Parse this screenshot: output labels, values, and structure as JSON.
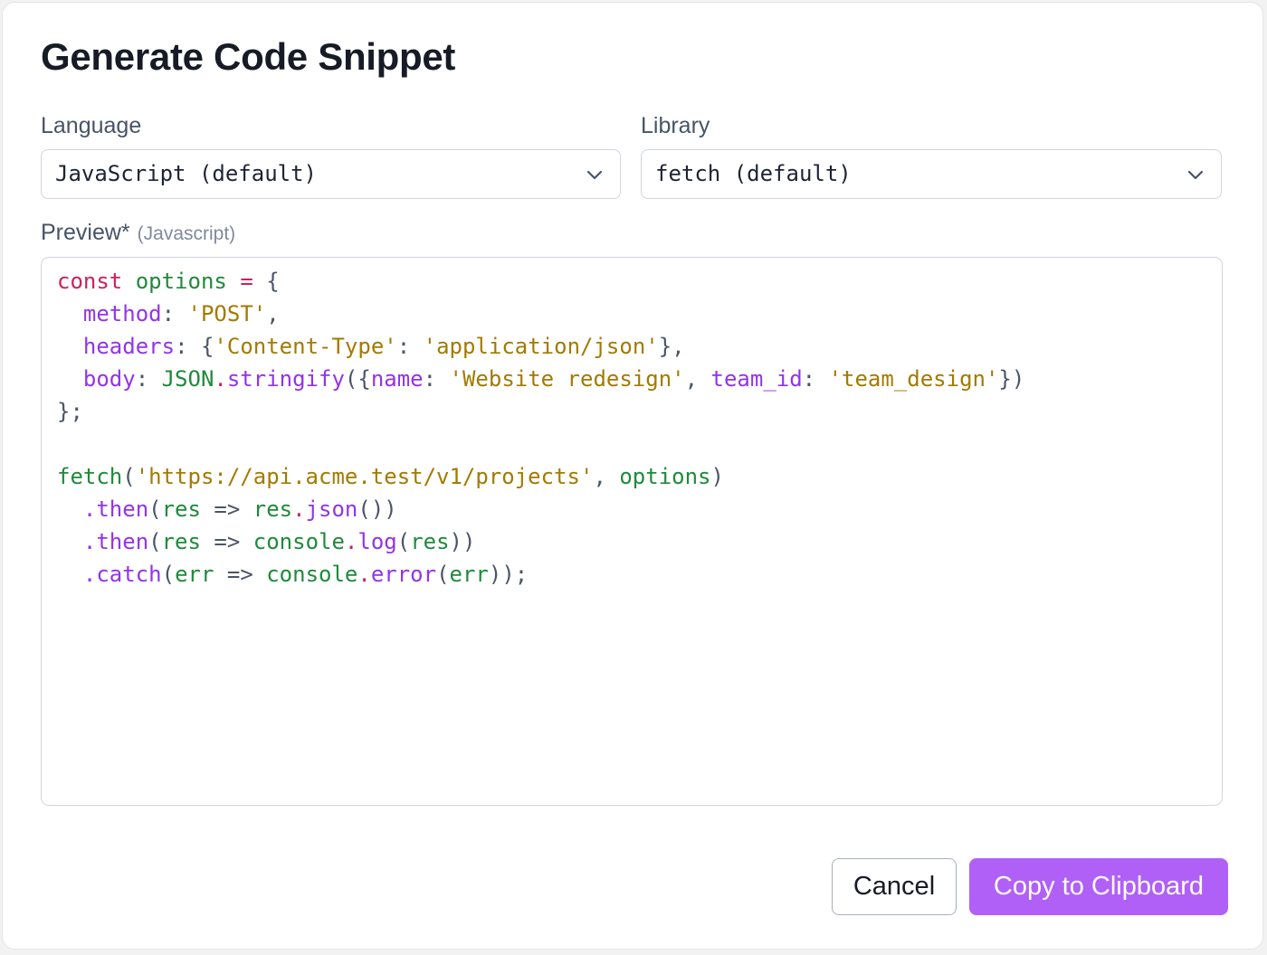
{
  "dialog": {
    "title": "Generate Code Snippet"
  },
  "language": {
    "label": "Language",
    "value": "JavaScript (default)",
    "icon": "chevron-down-icon"
  },
  "library": {
    "label": "Library",
    "value": "fetch (default)",
    "icon": "chevron-down-icon"
  },
  "preview": {
    "label": "Preview",
    "required_mark": "*",
    "language_hint": "(Javascript)",
    "lines": [
      [
        {
          "t": "const",
          "c": "keyword"
        },
        {
          "t": " ",
          "c": "plain"
        },
        {
          "t": "options",
          "c": "ident"
        },
        {
          "t": " ",
          "c": "plain"
        },
        {
          "t": "=",
          "c": "op"
        },
        {
          "t": " {",
          "c": "punct"
        }
      ],
      [
        {
          "t": "  ",
          "c": "plain"
        },
        {
          "t": "method",
          "c": "prop"
        },
        {
          "t": ": ",
          "c": "punct"
        },
        {
          "t": "'POST'",
          "c": "string"
        },
        {
          "t": ",",
          "c": "punct"
        }
      ],
      [
        {
          "t": "  ",
          "c": "plain"
        },
        {
          "t": "headers",
          "c": "prop"
        },
        {
          "t": ": {",
          "c": "punct"
        },
        {
          "t": "'Content-Type'",
          "c": "string"
        },
        {
          "t": ": ",
          "c": "punct"
        },
        {
          "t": "'application/json'",
          "c": "string"
        },
        {
          "t": "},",
          "c": "punct"
        }
      ],
      [
        {
          "t": "  ",
          "c": "plain"
        },
        {
          "t": "body",
          "c": "prop"
        },
        {
          "t": ": ",
          "c": "punct"
        },
        {
          "t": "JSON",
          "c": "ident"
        },
        {
          "t": ".",
          "c": "op"
        },
        {
          "t": "stringify",
          "c": "method"
        },
        {
          "t": "({",
          "c": "punct"
        },
        {
          "t": "name",
          "c": "prop"
        },
        {
          "t": ": ",
          "c": "punct"
        },
        {
          "t": "'Website redesign'",
          "c": "string"
        },
        {
          "t": ", ",
          "c": "punct"
        },
        {
          "t": "team_id",
          "c": "prop"
        },
        {
          "t": ": ",
          "c": "punct"
        },
        {
          "t": "'team_design'",
          "c": "string"
        },
        {
          "t": "})",
          "c": "punct"
        }
      ],
      [
        {
          "t": "};",
          "c": "punct"
        }
      ],
      [],
      [
        {
          "t": "fetch",
          "c": "ident"
        },
        {
          "t": "(",
          "c": "punct"
        },
        {
          "t": "'https://api.acme.test/v1/projects'",
          "c": "string"
        },
        {
          "t": ", ",
          "c": "punct"
        },
        {
          "t": "options",
          "c": "ident"
        },
        {
          "t": ")",
          "c": "punct"
        }
      ],
      [
        {
          "t": "  ",
          "c": "plain"
        },
        {
          "t": ".then",
          "c": "method"
        },
        {
          "t": "(",
          "c": "punct"
        },
        {
          "t": "res",
          "c": "ident"
        },
        {
          "t": " => ",
          "c": "punct"
        },
        {
          "t": "res",
          "c": "ident"
        },
        {
          "t": ".",
          "c": "op"
        },
        {
          "t": "json",
          "c": "method"
        },
        {
          "t": "())",
          "c": "punct"
        }
      ],
      [
        {
          "t": "  ",
          "c": "plain"
        },
        {
          "t": ".then",
          "c": "method"
        },
        {
          "t": "(",
          "c": "punct"
        },
        {
          "t": "res",
          "c": "ident"
        },
        {
          "t": " => ",
          "c": "punct"
        },
        {
          "t": "console",
          "c": "ident"
        },
        {
          "t": ".",
          "c": "op"
        },
        {
          "t": "log",
          "c": "method"
        },
        {
          "t": "(",
          "c": "punct"
        },
        {
          "t": "res",
          "c": "ident"
        },
        {
          "t": "))",
          "c": "punct"
        }
      ],
      [
        {
          "t": "  ",
          "c": "plain"
        },
        {
          "t": ".catch",
          "c": "method"
        },
        {
          "t": "(",
          "c": "punct"
        },
        {
          "t": "err",
          "c": "ident"
        },
        {
          "t": " => ",
          "c": "punct"
        },
        {
          "t": "console",
          "c": "ident"
        },
        {
          "t": ".",
          "c": "op"
        },
        {
          "t": "error",
          "c": "method"
        },
        {
          "t": "(",
          "c": "punct"
        },
        {
          "t": "err",
          "c": "ident"
        },
        {
          "t": "));",
          "c": "punct"
        }
      ]
    ]
  },
  "actions": {
    "cancel_label": "Cancel",
    "copy_label": "Copy to Clipboard"
  },
  "colors": {
    "accent": "#b160f7",
    "keyword": "#d01f5b",
    "identifier": "#1f8a3b",
    "property": "#9333ea",
    "string": "#a37a00"
  }
}
